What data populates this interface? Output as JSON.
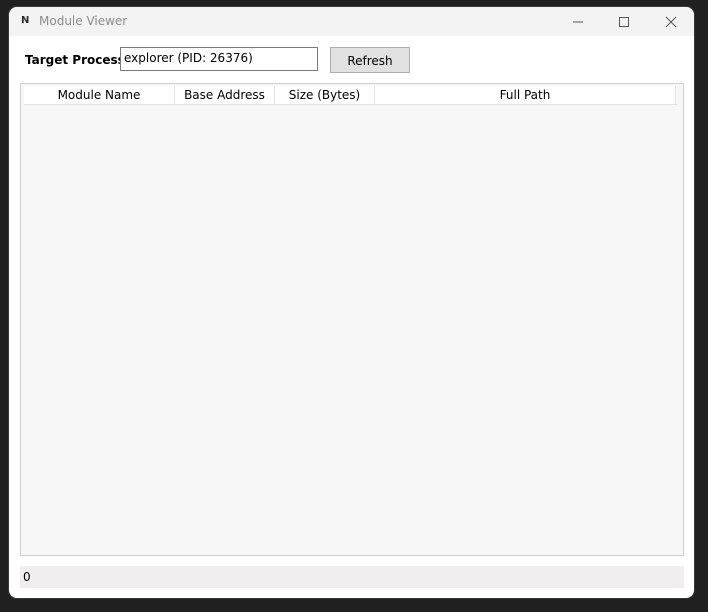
{
  "window": {
    "app_icon_glyph": "N",
    "title": "Module Viewer",
    "icons": [
      "minimize-icon",
      "maximize-icon",
      "close-icon"
    ]
  },
  "toolbar": {
    "target_label": "Target Process:",
    "process_value": "explorer (PID: 26376)",
    "refresh_label": "Refresh"
  },
  "module_list": {
    "columns": [
      "Module Name",
      "Base Address",
      "Size (Bytes)",
      "Full Path"
    ],
    "rows": []
  },
  "status": {
    "text": "0"
  },
  "colors": {
    "titlebar": "#f3f3f3",
    "list_background": "#f7f7f7",
    "button_face": "#e1e1e1",
    "status_background": "#f0eeee"
  }
}
